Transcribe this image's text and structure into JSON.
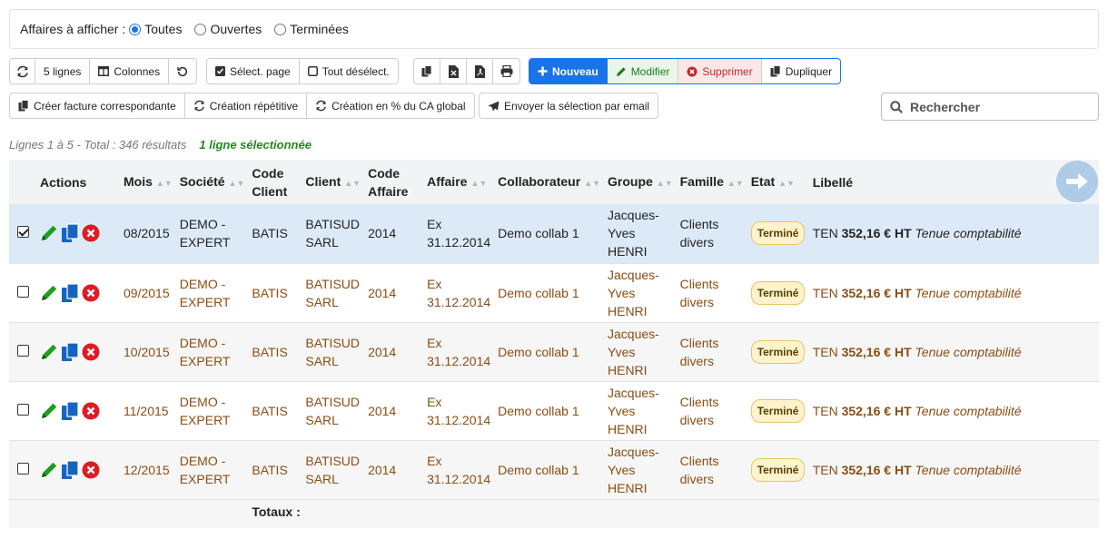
{
  "filter": {
    "label": "Affaires à afficher :",
    "options": [
      "Toutes",
      "Ouvertes",
      "Terminées"
    ],
    "selected": "Toutes"
  },
  "toolbar": {
    "lines": "5 lignes",
    "columns": "Colonnes",
    "select_page": "Sélect. page",
    "deselect_all": "Tout désélect.",
    "new": "Nouveau",
    "edit": "Modifier",
    "delete": "Supprimer",
    "duplicate": "Dupliquer",
    "create_invoice": "Créer facture correspondante",
    "repeat": "Création répétitive",
    "percent": "Création en % du CA global",
    "email": "Envoyer la sélection par email"
  },
  "search": {
    "placeholder": "Rechercher"
  },
  "info": {
    "range": "Lignes 1 à 5 - Total : 346 résultats",
    "selected": "1 ligne sélectionnée"
  },
  "table": {
    "headers": {
      "actions": "Actions",
      "mois": "Mois",
      "societe": "Société",
      "code_client_1": "Code",
      "code_client_2": "Client",
      "client": "Client",
      "code_affaire_1": "Code",
      "code_affaire_2": "Affaire",
      "affaire": "Affaire",
      "collab": "Collaborateur",
      "groupe": "Groupe",
      "famille": "Famille",
      "etat": "Etat",
      "libelle": "Libellé"
    },
    "rows": [
      {
        "mois": "08/2015",
        "societe_1": "DEMO -",
        "societe_2": "EXPERT",
        "code_client": "BATIS",
        "client_1": "BATISUD",
        "client_2": "SARL",
        "code_affaire": "2014",
        "affaire_1": "Ex",
        "affaire_2": "31.12.2014",
        "collab": "Demo collab 1",
        "groupe_1": "Jacques-",
        "groupe_2": "Yves",
        "groupe_3": "HENRI",
        "famille_1": "Clients",
        "famille_2": "divers",
        "etat": "Terminé",
        "lib_1": "TEN",
        "lib_2": "352,16 € HT",
        "lib_3": "Tenue comptabilité"
      },
      {
        "mois": "09/2015",
        "societe_1": "DEMO -",
        "societe_2": "EXPERT",
        "code_client": "BATIS",
        "client_1": "BATISUD",
        "client_2": "SARL",
        "code_affaire": "2014",
        "affaire_1": "Ex",
        "affaire_2": "31.12.2014",
        "collab": "Demo collab 1",
        "groupe_1": "Jacques-",
        "groupe_2": "Yves",
        "groupe_3": "HENRI",
        "famille_1": "Clients",
        "famille_2": "divers",
        "etat": "Terminé",
        "lib_1": "TEN",
        "lib_2": "352,16 € HT",
        "lib_3": "Tenue comptabilité"
      },
      {
        "mois": "10/2015",
        "societe_1": "DEMO -",
        "societe_2": "EXPERT",
        "code_client": "BATIS",
        "client_1": "BATISUD",
        "client_2": "SARL",
        "code_affaire": "2014",
        "affaire_1": "Ex",
        "affaire_2": "31.12.2014",
        "collab": "Demo collab 1",
        "groupe_1": "Jacques-",
        "groupe_2": "Yves",
        "groupe_3": "HENRI",
        "famille_1": "Clients",
        "famille_2": "divers",
        "etat": "Terminé",
        "lib_1": "TEN",
        "lib_2": "352,16 € HT",
        "lib_3": "Tenue comptabilité"
      },
      {
        "mois": "11/2015",
        "societe_1": "DEMO -",
        "societe_2": "EXPERT",
        "code_client": "BATIS",
        "client_1": "BATISUD",
        "client_2": "SARL",
        "code_affaire": "2014",
        "affaire_1": "Ex",
        "affaire_2": "31.12.2014",
        "collab": "Demo collab 1",
        "groupe_1": "Jacques-",
        "groupe_2": "Yves",
        "groupe_3": "HENRI",
        "famille_1": "Clients",
        "famille_2": "divers",
        "etat": "Terminé",
        "lib_1": "TEN",
        "lib_2": "352,16 € HT",
        "lib_3": "Tenue comptabilité"
      },
      {
        "mois": "12/2015",
        "societe_1": "DEMO -",
        "societe_2": "EXPERT",
        "code_client": "BATIS",
        "client_1": "BATISUD",
        "client_2": "SARL",
        "code_affaire": "2014",
        "affaire_1": "Ex",
        "affaire_2": "31.12.2014",
        "collab": "Demo collab 1",
        "groupe_1": "Jacques-",
        "groupe_2": "Yves",
        "groupe_3": "HENRI",
        "famille_1": "Clients",
        "famille_2": "divers",
        "etat": "Terminé",
        "lib_1": "TEN",
        "lib_2": "352,16 € HT",
        "lib_3": "Tenue comptabilité"
      }
    ],
    "totals_label": "Totaux :"
  },
  "colors": {
    "primary": "#1a73e8",
    "row_text": "#8b4d12",
    "selected_row": "#dceaf8",
    "badge_bg": "#fff3cd"
  }
}
